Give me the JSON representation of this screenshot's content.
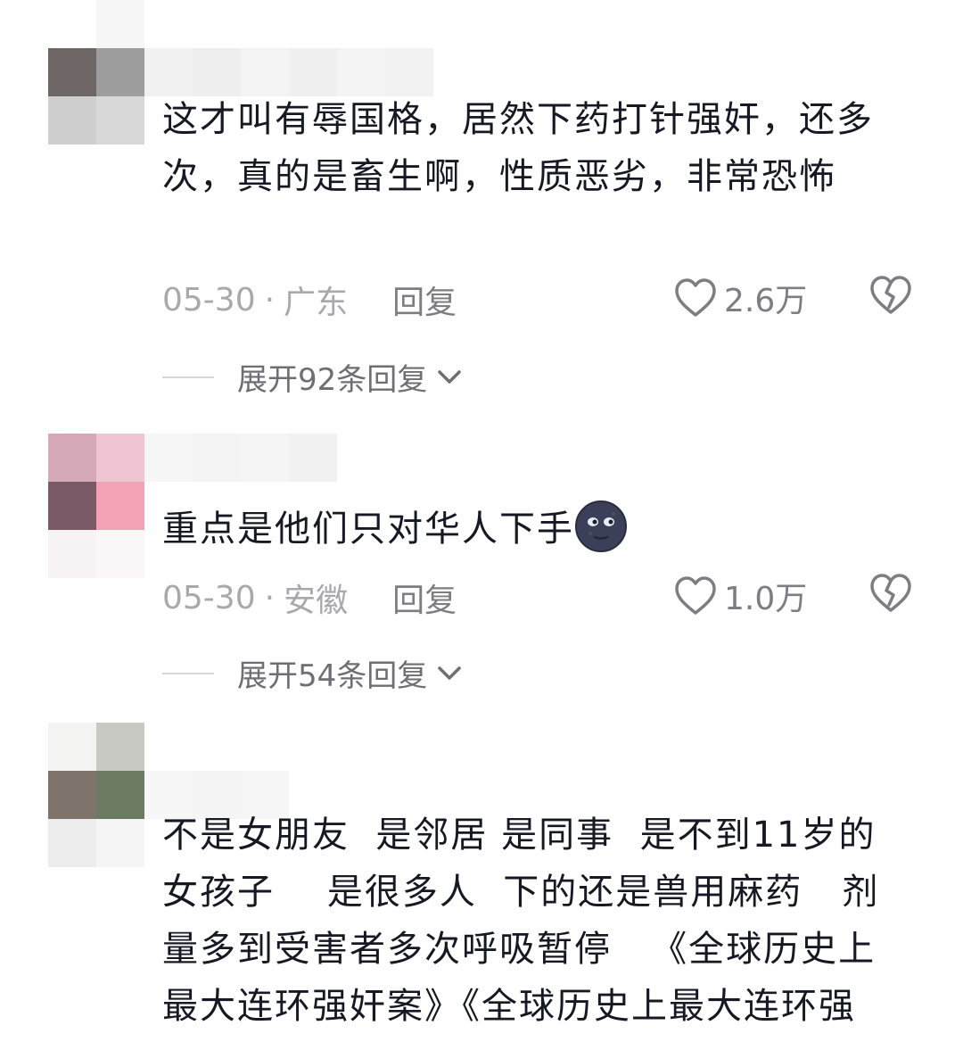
{
  "comments": [
    {
      "text": "这才叫有辱国格，居然下药打针强奸，还多次，真的是畜生啊，性质恶劣，非常恐怖",
      "date": "05-30",
      "separator": "·",
      "location": "广东",
      "reply_label": "回复",
      "likes": "2.6万",
      "expand_label": "展开92条回复"
    },
    {
      "text": "重点是他们只对华人下手",
      "emoji": "new-moon-face",
      "date": "05-30",
      "separator": "·",
      "location": "安徽",
      "reply_label": "回复",
      "likes": "1.0万",
      "expand_label": "展开54条回复"
    },
    {
      "text": "不是女朋友  是邻居 是同事  是不到11岁的女孩子    是很多人  下的还是兽用麻药   剂量多到受害者多次呼吸暂停   《全球历史上最大连环强奸案》《全球历史上最大连环强"
    }
  ],
  "colors": {
    "text": "#161823",
    "meta": "#a8a8ad",
    "action": "#7d7d83"
  },
  "icons": {
    "like": "heart-outline-icon",
    "dislike": "broken-heart-icon",
    "expand": "chevron-down-icon"
  }
}
